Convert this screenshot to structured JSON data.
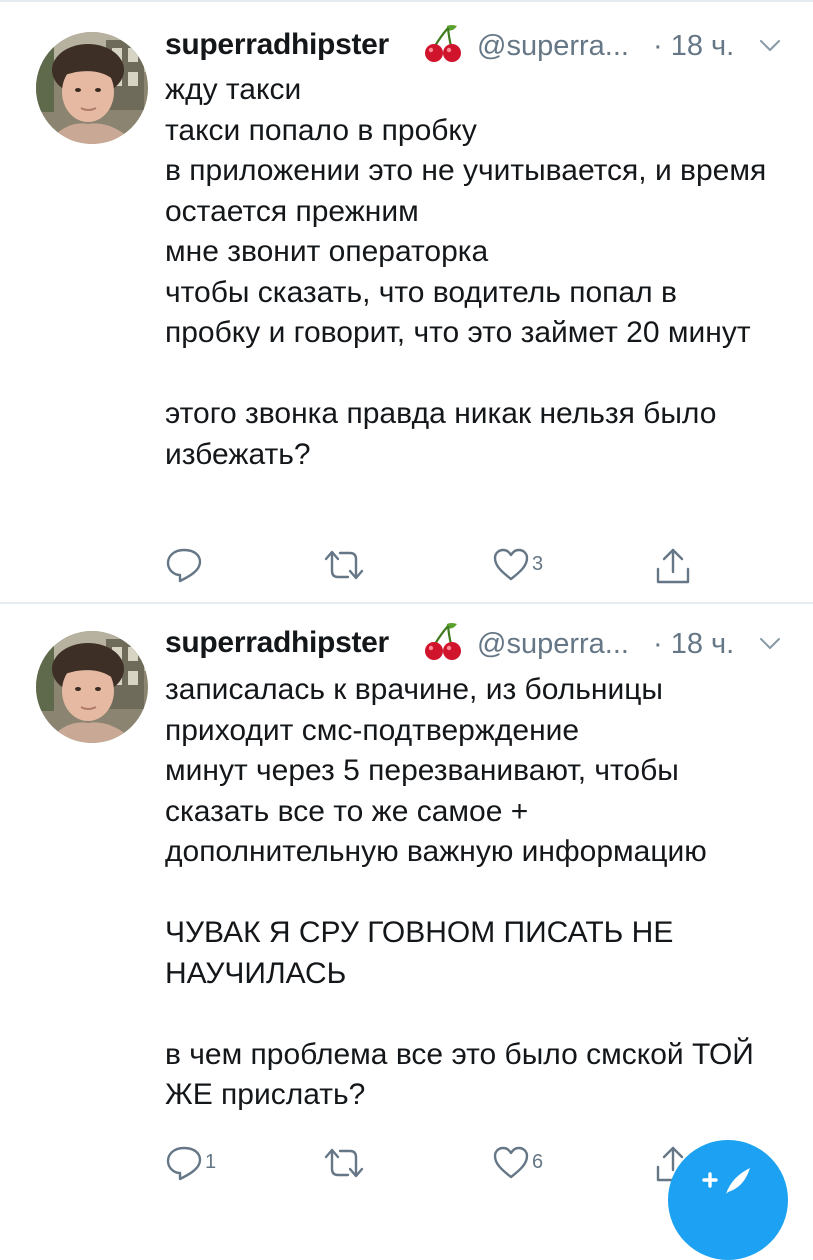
{
  "timeline": {
    "tweets": [
      {
        "display_name": "superradhipster",
        "name_emoji": "cherry-icon",
        "handle": "@superra...",
        "time": "· 18 ч.",
        "text": "жду такси\nтакси попало в пробку\nв приложении это не учитывается, и время остается прежним\nмне звонит операторка\nчтобы сказать, что водитель попал в пробку и говорит, что это займет 20 минут\n\nэтого звонка правда никак нельзя было избежать?",
        "reply_count": "",
        "retweet_count": "",
        "like_count": "3"
      },
      {
        "display_name": "superradhipster",
        "name_emoji": "cherry-icon",
        "handle": "@superra...",
        "time": "· 18 ч.",
        "text": "записалась к врачине, из больницы приходит смс-подтверждение\nминут через 5перезванивают, чтобы сказать все то же самое +\nдополнительную важную информацию\n\nЧУВАК Я СРУ ГОВНОМ ПИСАТЬ НЕ НАУЧИЛАСЬ\n\nв чем проблема все это было смской ТОЙ ЖЕ прислать?",
        "reply_count": "1",
        "retweet_count": "",
        "like_count": "6"
      }
    ]
  },
  "icons": {
    "reply": "reply-icon",
    "retweet": "retweet-icon",
    "like": "heart-icon",
    "share": "share-icon",
    "menu": "chevron-down-icon",
    "compose": "compose-tweet-icon"
  },
  "colors": {
    "text": "#14171a",
    "secondary": "#657786",
    "separator": "#e6ecf0",
    "accent": "#1da1f2"
  }
}
